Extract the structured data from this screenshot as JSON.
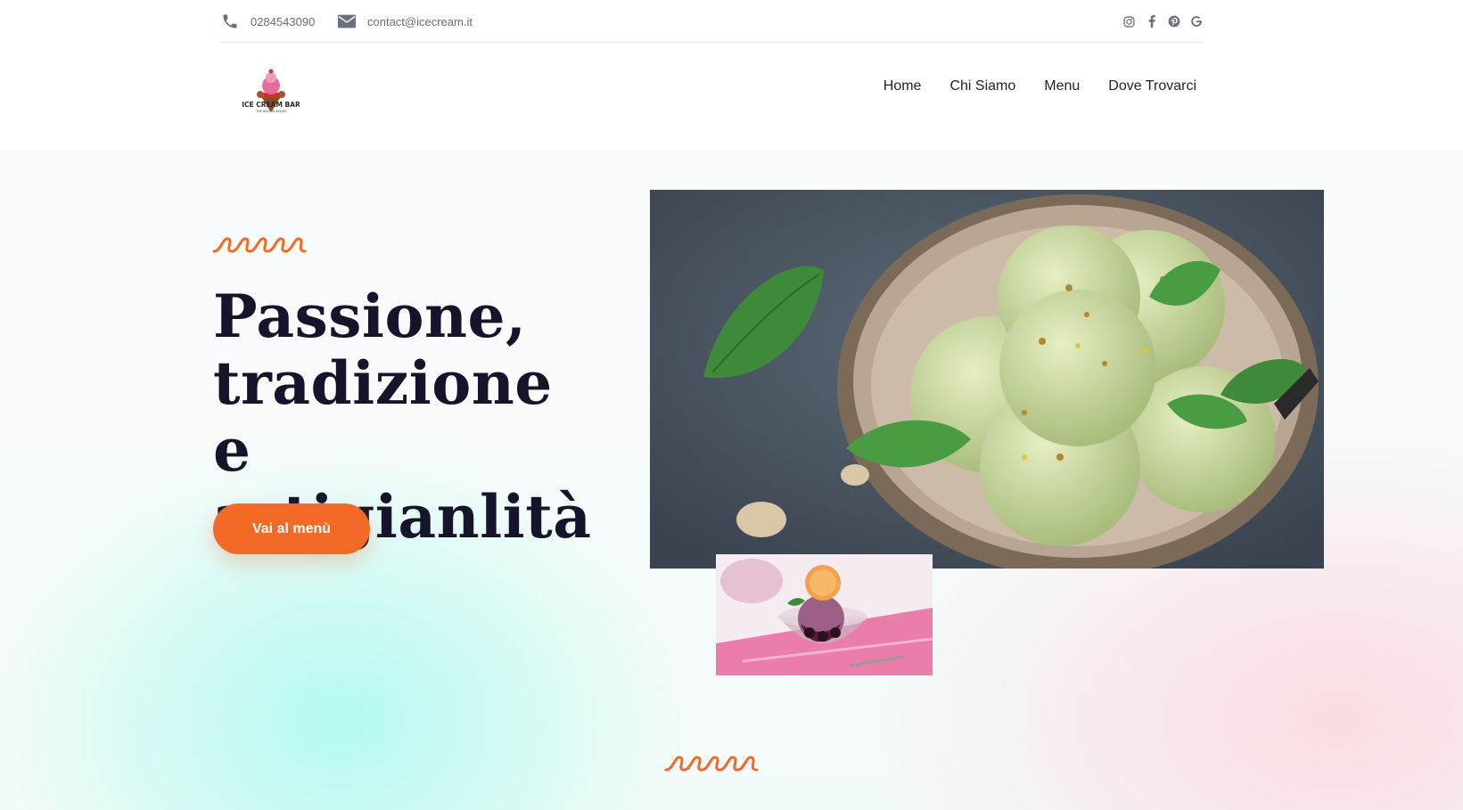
{
  "topbar": {
    "phone": "0284543090",
    "email": "contact@icecream.it",
    "socials": [
      "instagram-icon",
      "facebook-icon",
      "pinterest-icon",
      "google-icon"
    ]
  },
  "logo": {
    "title": "ICE CREAM BAR",
    "tagline": "THE BEST IN MILAN"
  },
  "nav": {
    "items": [
      "Home",
      "Chi Siamo",
      "Menu",
      "Dove Trovarci"
    ]
  },
  "hero": {
    "title_line1": "Passione,",
    "title_line2": "tradizione e",
    "title_line3": "artigianlità",
    "cta_label": "Vai al menù"
  },
  "colors": {
    "accent": "#f26a25",
    "heading": "#14152b",
    "muted_text": "#6b6b75"
  }
}
